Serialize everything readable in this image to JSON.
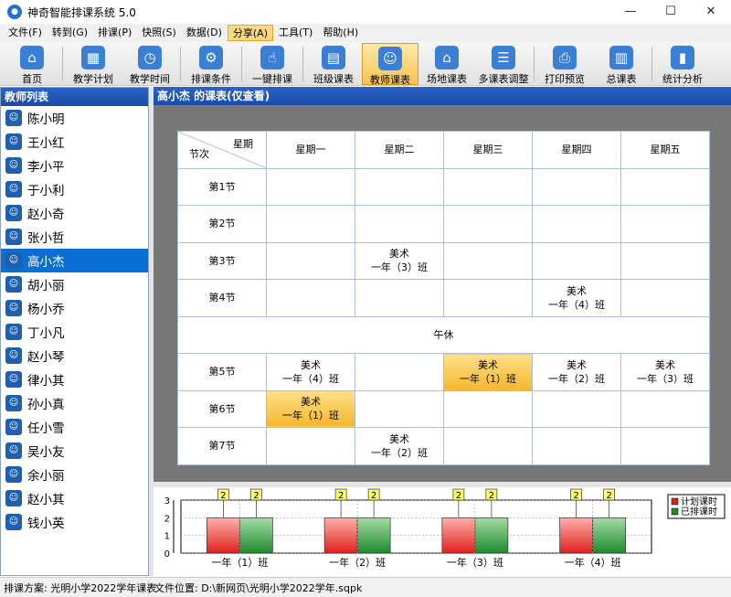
{
  "window": {
    "title": "神奇智能排课系统 5.0",
    "minimize": "—",
    "maximize": "☐",
    "close": "✕"
  },
  "menu": [
    "文件(F)",
    "转到(G)",
    "排课(P)",
    "快照(S)",
    "数据(D)",
    "分享(A)",
    "工具(T)",
    "帮助(H)"
  ],
  "menu_active": "分享(A)",
  "toolbar": [
    {
      "label": "首页",
      "icon": "home-icon",
      "glyph": "⌂"
    },
    {
      "label": "教学计划",
      "icon": "plan-icon",
      "glyph": "▦"
    },
    {
      "label": "教学时间",
      "icon": "clock-icon",
      "glyph": "◷"
    },
    {
      "label": "排课条件",
      "icon": "conditions-icon",
      "glyph": "⚙"
    },
    {
      "label": "一键排课",
      "icon": "click-icon",
      "glyph": "☝"
    },
    {
      "label": "班级课表",
      "icon": "class-schedule-icon",
      "glyph": "▤"
    },
    {
      "label": "教师课表",
      "icon": "teacher-schedule-icon",
      "glyph": "☺"
    },
    {
      "label": "场地课表",
      "icon": "venue-schedule-icon",
      "glyph": "⌂"
    },
    {
      "label": "多课表调整",
      "icon": "multi-adjust-icon",
      "glyph": "☰"
    },
    {
      "label": "打印预览",
      "icon": "print-icon",
      "glyph": "⎙"
    },
    {
      "label": "总课表",
      "icon": "total-schedule-icon",
      "glyph": "▥"
    },
    {
      "label": "统计分析",
      "icon": "stats-icon",
      "glyph": "▮"
    }
  ],
  "toolbar_active": "教师课表",
  "left_panel": {
    "title": "教师列表",
    "teachers": [
      "陈小明",
      "王小红",
      "李小平",
      "于小利",
      "赵小奇",
      "张小哲",
      "高小杰",
      "胡小丽",
      "杨小乔",
      "丁小凡",
      "赵小琴",
      "律小其",
      "孙小真",
      "任小雪",
      "吴小友",
      "余小丽",
      "赵小其",
      "钱小英"
    ],
    "selected": "高小杰"
  },
  "right_panel": {
    "title": "高小杰 的课表(仅查看)"
  },
  "schedule": {
    "corner_day": "星期",
    "corner_period": "节次",
    "days": [
      "星期一",
      "星期二",
      "星期三",
      "星期四",
      "星期五"
    ],
    "periods": [
      "第1节",
      "第2节",
      "第3节",
      "第4节",
      "第5节",
      "第6节",
      "第7节"
    ],
    "lunch_break": "午休",
    "cells": [
      [
        "",
        "",
        "",
        "",
        ""
      ],
      [
        "",
        "",
        "",
        "",
        ""
      ],
      [
        "",
        "美术\n一年（3）班",
        "",
        "",
        ""
      ],
      [
        "",
        "",
        "",
        "美术\n一年（4）班",
        ""
      ],
      [
        "美术\n一年（4）班",
        "",
        "美术\n一年（1）班",
        "美术\n一年（2）班",
        "美术\n一年（3）班"
      ],
      [
        "美术\n一年（1）班",
        "",
        "",
        "",
        ""
      ],
      [
        "",
        "美术\n一年（2）班",
        "",
        "",
        ""
      ]
    ],
    "highlight": [
      [
        4,
        2
      ],
      [
        5,
        0
      ]
    ]
  },
  "chart_data": {
    "type": "bar",
    "categories": [
      "一年（1）班",
      "一年（2）班",
      "一年（3）班",
      "一年（4）班"
    ],
    "series": [
      {
        "name": "计划课时",
        "values": [
          2,
          2,
          2,
          2
        ],
        "color": "#e0201c"
      },
      {
        "name": "已排课时",
        "values": [
          2,
          2,
          2,
          2
        ],
        "color": "#1e8a2c"
      }
    ],
    "ylim": [
      0,
      3
    ],
    "yticks": [
      "0",
      "1",
      "2",
      "3"
    ],
    "data_labels": [
      "2",
      "2",
      "2",
      "2",
      "2",
      "2",
      "2",
      "2"
    ],
    "legend": "right"
  },
  "status": {
    "plan": "排课方案:   光明小学2022学年课表",
    "file": "文件位置:   D:\\新网页\\光明小学2022学年.sqpk"
  }
}
